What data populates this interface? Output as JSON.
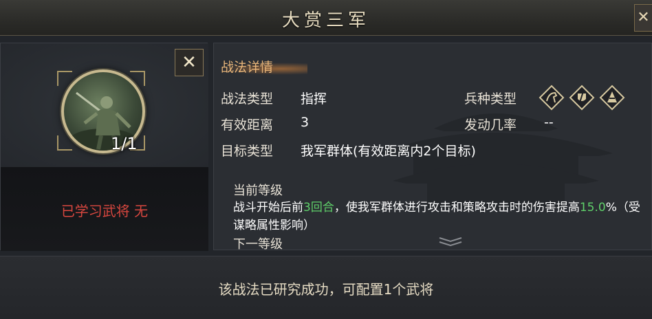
{
  "window": {
    "title": "大赏三军",
    "close_icon": "close-icon"
  },
  "left_panel": {
    "close_label": "✕",
    "count": "1/1",
    "learned_text": "已学习武将 无"
  },
  "detail": {
    "section_title": "战法详情",
    "rows": [
      {
        "label": "战法类型",
        "value": "指挥"
      },
      {
        "label": "有效距离",
        "value": "3"
      },
      {
        "label": "目标类型",
        "value": "我军群体(有效距离内2个目标)"
      }
    ],
    "troop_type_label": "兵种类型",
    "troop_icons": [
      "cavalry-icon",
      "shield-icon",
      "archer-icon"
    ],
    "trigger_rate_label": "发动几率",
    "trigger_rate_value": "--"
  },
  "description": {
    "current_label": "当前等级",
    "text_part1": "战斗开始后前",
    "highlight1": "3回合",
    "text_part2": "，使我军群体进行攻击和策略攻击时的伤害提高",
    "highlight2": "15.0",
    "text_part3": "%（受谋略属性影响）",
    "next_label": "下一等级",
    "expand_icon": "double-chevron-down-icon"
  },
  "footer": {
    "text": "该战法已研究成功，可配置1个武将"
  },
  "colors": {
    "accent_gold": "#c7b98f",
    "section_title": "#e9b67a",
    "learned_red": "#d9473f",
    "highlight_green": "#5fd06a"
  }
}
